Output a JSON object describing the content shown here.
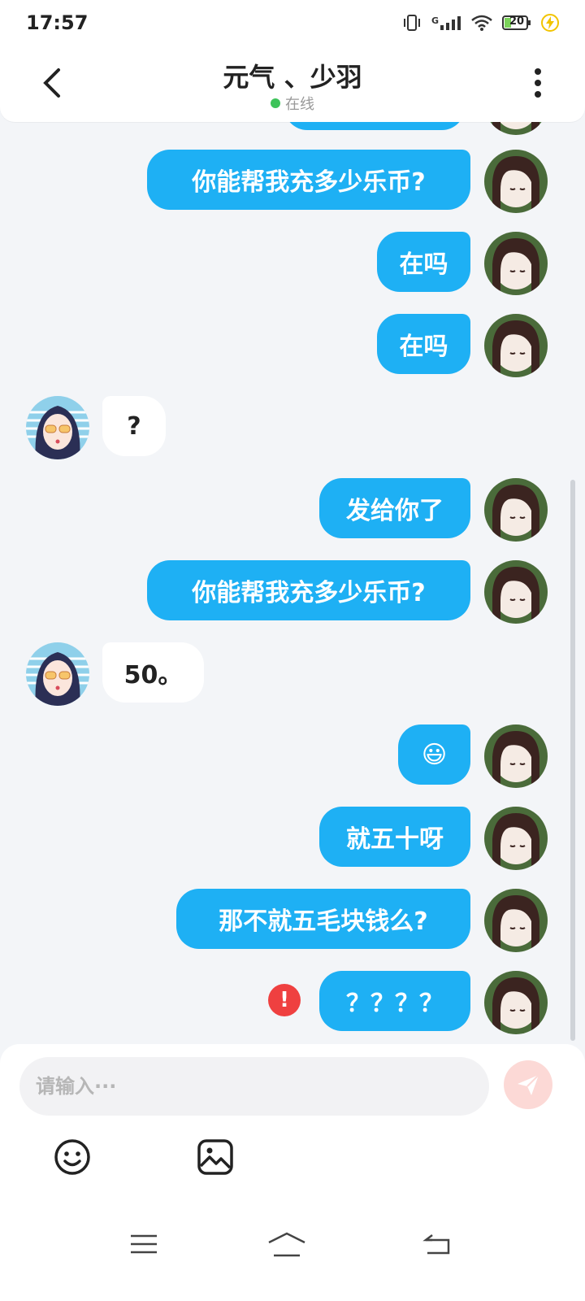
{
  "status_bar": {
    "time": "17:57",
    "battery": "20",
    "signal_label": "G"
  },
  "header": {
    "title": "元气 、少羽",
    "status": "在线"
  },
  "messages": [
    {
      "dir": "out",
      "text": "你能帮我充多少乐币?"
    },
    {
      "dir": "out",
      "text": "在吗"
    },
    {
      "dir": "out",
      "text": "在吗"
    },
    {
      "dir": "in",
      "text": "?"
    },
    {
      "dir": "out",
      "text": "发给你了"
    },
    {
      "dir": "out",
      "text": "你能帮我充多少乐币?"
    },
    {
      "dir": "in",
      "text": "50。"
    },
    {
      "dir": "out",
      "text": "😃"
    },
    {
      "dir": "out",
      "text": "就五十呀"
    },
    {
      "dir": "out",
      "text": "那不就五毛块钱么?"
    },
    {
      "dir": "out",
      "text": "？？？？",
      "failed": true
    }
  ],
  "error_mark": "!",
  "composer": {
    "placeholder": "请输入···"
  },
  "colors": {
    "outgoing_bubble": "#1eb0f4",
    "incoming_bubble": "#ffffff",
    "online": "#3ec35a",
    "error": "#ef4040"
  }
}
